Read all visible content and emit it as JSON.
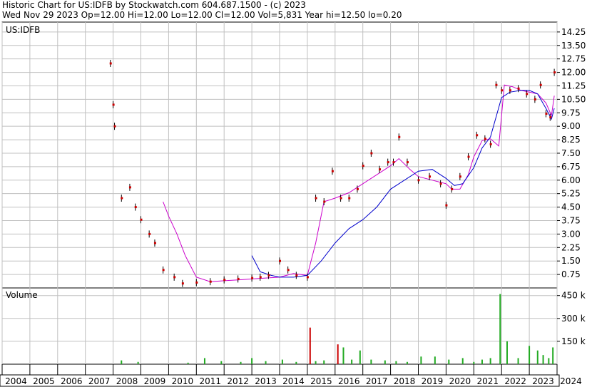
{
  "header": {
    "line1": "Historic Chart for US:IDFB by Stockwatch.com 604.687.1500 - (c) 2023",
    "line2": "Wed Nov 29 2023   Op=12.00  Hi=12.00  Lo=12.00  Cl=12.00  Vol=5,831  Year hi=12.50  lo=0.20"
  },
  "colors": {
    "price": "#cc0000",
    "bar": "#000000",
    "ma_short": "#cc00cc",
    "ma_long": "#0000cc",
    "vol_up": "#22aa22",
    "vol_down": "#cc0000",
    "grid": "#c0c0c0"
  },
  "chart_data": [
    {
      "type": "line",
      "title": "US:IDFB",
      "x": [
        2007.9,
        2008.0,
        2008.05,
        2008.3,
        2008.6,
        2008.8,
        2009.0,
        2009.3,
        2009.5,
        2009.8,
        2010.2,
        2010.5,
        2011.0,
        2011.5,
        2012.0,
        2012.5,
        2013.0,
        2013.3,
        2013.6,
        2014.0,
        2014.3,
        2014.6,
        2015.0,
        2015.3,
        2015.6,
        2015.9,
        2016.2,
        2016.5,
        2016.8,
        2017.0,
        2017.3,
        2017.6,
        2017.9,
        2018.1,
        2018.3,
        2018.6,
        2019.0,
        2019.4,
        2019.8,
        2020.0,
        2020.2,
        2020.5,
        2020.8,
        2021.1,
        2021.4,
        2021.6,
        2021.8,
        2022.0,
        2022.3,
        2022.6,
        2022.9,
        2023.2,
        2023.4,
        2023.6,
        2023.75,
        2023.9
      ],
      "ylim": [
        0,
        14.8
      ],
      "yticks": [
        "0.75",
        "1.50",
        "2.25",
        "3.00",
        "3.75",
        "4.50",
        "5.25",
        "6.00",
        "6.75",
        "7.50",
        "8.25",
        "9.00",
        "9.75",
        "10.50",
        "11.25",
        "12.00",
        "12.75",
        "13.50",
        "14.25"
      ],
      "series": [
        {
          "values": [
            12.5,
            10.2,
            9.0,
            5.0,
            5.6,
            4.5,
            3.8,
            3.0,
            2.5,
            1.0,
            0.6,
            0.25,
            0.3,
            0.35,
            0.45,
            0.5,
            0.55,
            0.6,
            0.7,
            1.5,
            1.0,
            0.7,
            0.6,
            5.0,
            4.8,
            6.5,
            5.0,
            5.0,
            5.5,
            6.8,
            7.5,
            6.6,
            7.0,
            7.0,
            8.4,
            7.0,
            6.0,
            6.2,
            5.8,
            4.6,
            5.5,
            6.2,
            7.3,
            8.5,
            8.3,
            8.0,
            11.3,
            11.0,
            11.0,
            11.1,
            10.8,
            10.5,
            11.3,
            9.7,
            9.5,
            12.0
          ]
        }
      ]
    },
    {
      "type": "bar",
      "title": "Volume",
      "yticks": [
        "150 k",
        "300 k",
        "450 k"
      ],
      "ylim": [
        0,
        500
      ],
      "x": [
        2008.3,
        2008.9,
        2010.7,
        2011.3,
        2011.9,
        2012.6,
        2013.0,
        2013.5,
        2014.1,
        2014.6,
        2015.1,
        2015.3,
        2015.6,
        2016.1,
        2016.3,
        2016.6,
        2016.9,
        2017.3,
        2017.8,
        2018.2,
        2018.6,
        2019.1,
        2019.6,
        2020.1,
        2020.6,
        2021.0,
        2021.3,
        2021.6,
        2021.95,
        2022.2,
        2022.6,
        2023.0,
        2023.3,
        2023.5,
        2023.7,
        2023.85
      ],
      "values": [
        25,
        15,
        10,
        40,
        20,
        15,
        40,
        20,
        30,
        15,
        240,
        20,
        25,
        130,
        110,
        30,
        90,
        30,
        25,
        20,
        15,
        50,
        50,
        30,
        40,
        15,
        30,
        40,
        460,
        150,
        40,
        120,
        90,
        60,
        40,
        110
      ],
      "direction": [
        "up",
        "up",
        "up",
        "up",
        "up",
        "up",
        "up",
        "up",
        "up",
        "up",
        "down",
        "up",
        "up",
        "down",
        "up",
        "up",
        "up",
        "up",
        "up",
        "up",
        "up",
        "up",
        "up",
        "up",
        "up",
        "up",
        "up",
        "up",
        "up",
        "up",
        "up",
        "up",
        "up",
        "up",
        "up",
        "up"
      ]
    }
  ],
  "x_axis": {
    "labels": [
      "2004",
      "2005",
      "2006",
      "2007",
      "2008",
      "2009",
      "2010",
      "2011",
      "2012",
      "2013",
      "2014",
      "2015",
      "2016",
      "2017",
      "2018",
      "2019",
      "2020",
      "2021",
      "2022",
      "2023",
      "2024"
    ]
  },
  "ma_short": {
    "x": [
      2009.8,
      2010.0,
      2010.3,
      2010.6,
      2011.0,
      2011.5,
      2012.0,
      2012.5,
      2013.0,
      2013.5,
      2014.0,
      2014.5,
      2015.0,
      2015.3,
      2015.6,
      2016.0,
      2016.5,
      2017.0,
      2017.5,
      2018.0,
      2018.3,
      2018.7,
      2019.0,
      2019.5,
      2020.0,
      2020.2,
      2020.5,
      2020.8,
      2021.0,
      2021.3,
      2021.6,
      2021.9,
      2022.1,
      2022.4,
      2022.7,
      2023.0,
      2023.3,
      2023.6,
      2023.8,
      2023.9
    ],
    "values": [
      4.8,
      4.0,
      3.0,
      1.8,
      0.6,
      0.35,
      0.4,
      0.45,
      0.5,
      0.55,
      0.6,
      0.8,
      0.7,
      2.5,
      4.8,
      5.0,
      5.3,
      5.8,
      6.3,
      6.8,
      7.2,
      6.6,
      6.2,
      6.0,
      5.8,
      5.5,
      5.5,
      6.3,
      7.3,
      8.2,
      8.3,
      7.9,
      11.3,
      11.2,
      11.0,
      10.9,
      10.8,
      10.3,
      9.6,
      10.7
    ]
  },
  "ma_long": {
    "x": [
      2013.0,
      2013.3,
      2013.7,
      2014.0,
      2014.5,
      2015.0,
      2015.5,
      2016.0,
      2016.5,
      2017.0,
      2017.5,
      2018.0,
      2018.5,
      2019.0,
      2019.5,
      2020.0,
      2020.3,
      2020.6,
      2021.0,
      2021.3,
      2021.6,
      2022.0,
      2022.3,
      2022.7,
      2023.0,
      2023.3,
      2023.6,
      2023.8,
      2023.9
    ],
    "values": [
      1.8,
      0.9,
      0.7,
      0.6,
      0.6,
      0.7,
      1.5,
      2.5,
      3.3,
      3.8,
      4.5,
      5.5,
      6.0,
      6.5,
      6.6,
      6.1,
      5.7,
      5.8,
      6.7,
      7.8,
      8.4,
      10.6,
      10.9,
      11.0,
      11.0,
      10.8,
      10.0,
      9.4,
      10.0
    ]
  }
}
